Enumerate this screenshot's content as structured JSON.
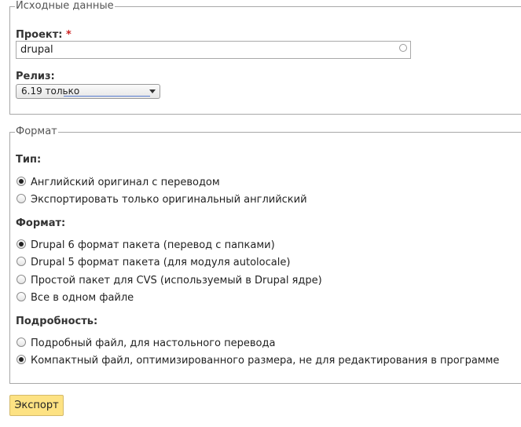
{
  "source": {
    "legend": "Исходные данные",
    "project_label": "Проект:",
    "required_mark": "*",
    "project_value": "drupal",
    "release_label": "Релиз:",
    "release_selected": "6.19 только"
  },
  "format": {
    "legend": "Формат",
    "type_label": "Тип:",
    "type_options": [
      {
        "label": "Английский оригинал с переводом",
        "checked": true
      },
      {
        "label": "Экспортировать только оригинальный английский",
        "checked": false
      }
    ],
    "format_label": "Формат:",
    "format_options": [
      {
        "label": "Drupal 6 формат пакета (перевод с папками)",
        "checked": true
      },
      {
        "label": "Drupal 5 формат пакета (для модуля autolocale)",
        "checked": false
      },
      {
        "label": "Простой пакет для CVS (используемый в Drupal ядре)",
        "checked": false
      },
      {
        "label": "Все в одном файле",
        "checked": false
      }
    ],
    "verbosity_label": "Подробность:",
    "verbosity_options": [
      {
        "label": "Подробный файл, для настольного перевода",
        "checked": false
      },
      {
        "label": "Компактный файл, оптимизированного размера, не для редактирования в программе",
        "checked": true
      }
    ]
  },
  "submit_label": "Экспорт",
  "colors": {
    "button_bg": "#fde283",
    "button_border": "#d3b96a",
    "required": "#cc2222",
    "border": "#a8a8a8"
  }
}
